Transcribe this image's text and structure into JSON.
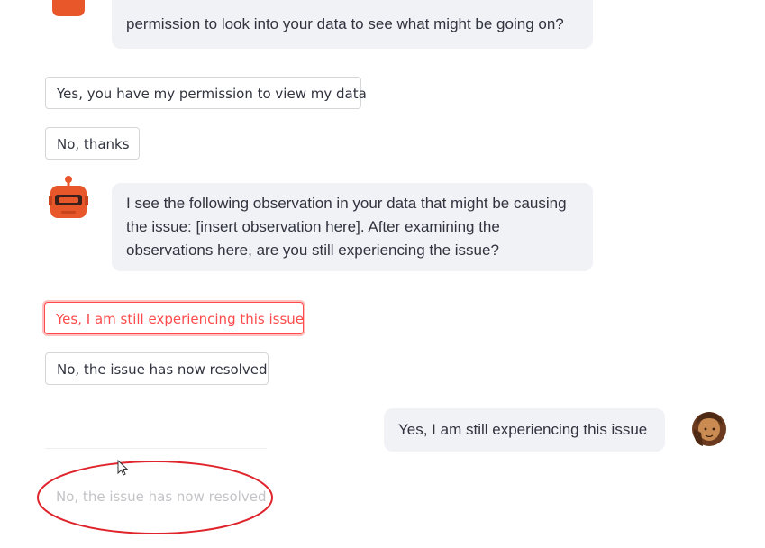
{
  "messages": {
    "bot_1_text": "permission to look into your data to see what might be going on?",
    "bot_2_line1": "I see the following observation in your data that might be causing",
    "bot_2_line2": "the issue: [insert observation here]. After examining the",
    "bot_2_line3": "observations here, are you still experiencing the issue?",
    "user_1_text": "Yes, I am still experiencing this issue"
  },
  "buttons": {
    "permission_yes": "Yes, you have my permission to view my data",
    "permission_no": "No, thanks",
    "still_experiencing": "Yes, I am still experiencing this issue",
    "resolved": "No, the issue has now resolved",
    "resolved_faded": "No, the issue has now resolved"
  },
  "colors": {
    "accent": "#ff4b4b",
    "bubble_bg": "#f0f2f6",
    "annotation": "#e0242c",
    "bot_avatar": "#e8572a"
  },
  "icons": {
    "bot": "robot-icon",
    "user": "user-avatar-icon",
    "cursor": "mouse-cursor-icon"
  }
}
